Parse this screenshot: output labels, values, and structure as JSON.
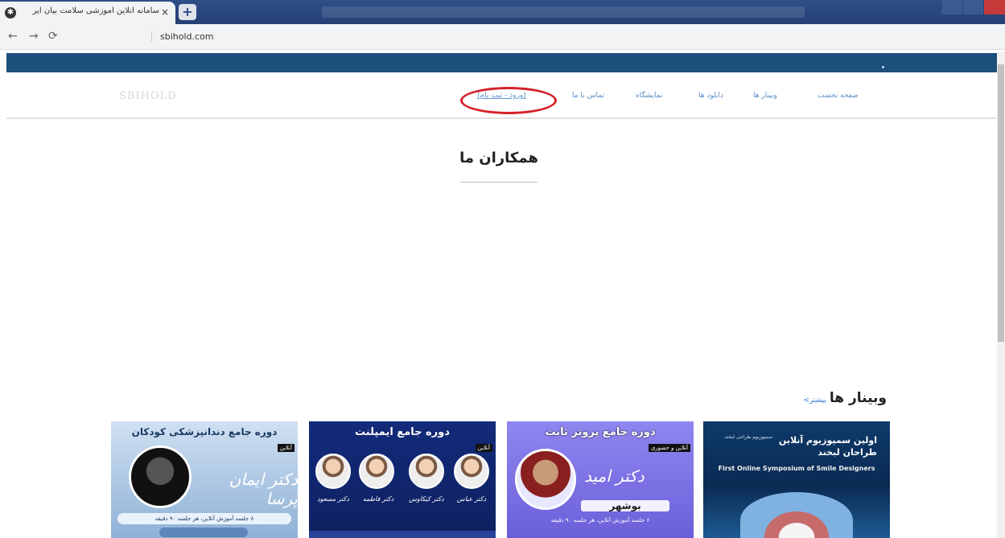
{
  "browser": {
    "tab_title": "سامانه آنلاین آموزشی سلامت بیان ایرانیان",
    "tab_close": "×",
    "new_tab": "+",
    "url": "sbihold.com"
  },
  "site": {
    "logo_text": "SBIHOLD",
    "menu": [
      {
        "label": "صفحه نخست"
      },
      {
        "label": "وبینار ها"
      },
      {
        "label": "دانلود ها"
      },
      {
        "label": "نمایشگاه"
      },
      {
        "label": "تماس با ما"
      },
      {
        "label": "(ورود - ثبت نام)"
      }
    ],
    "section_title": "همکاران ما",
    "webinars": {
      "title": "وبینار ها",
      "more": "بیشتر>"
    }
  },
  "cards": [
    {
      "title": "دوره جامع دندانپزشکی کودکان",
      "badge": "آنلاین",
      "name": "دکتر ایمان پرسا",
      "strip": "۸ جلسه آموزش آنلاین، هر جلسه ۹۰ دقیقه"
    },
    {
      "title": "دوره جامع ایمپلنت",
      "badge": "آنلاین",
      "captions": [
        "دکتر مسعود",
        "دکتر فاطمه",
        "دکتر کیکاوس",
        "دکتر عباس"
      ]
    },
    {
      "title": "دوره جامع پروتز ثابت",
      "badge": "آنلاین و حضوری",
      "name": "دکتر امید",
      "city": "بوشهر",
      "info": "۶ جلسه آموزش آنلاین، هر جلسه ۹۰ دقیقه"
    },
    {
      "title": "اولین سمپوزیوم آنلاین طراحان لبخند",
      "organizer": "سمپوزیوم طراحی لبخند",
      "english": "First Online Symposium of Smile Designers"
    }
  ]
}
